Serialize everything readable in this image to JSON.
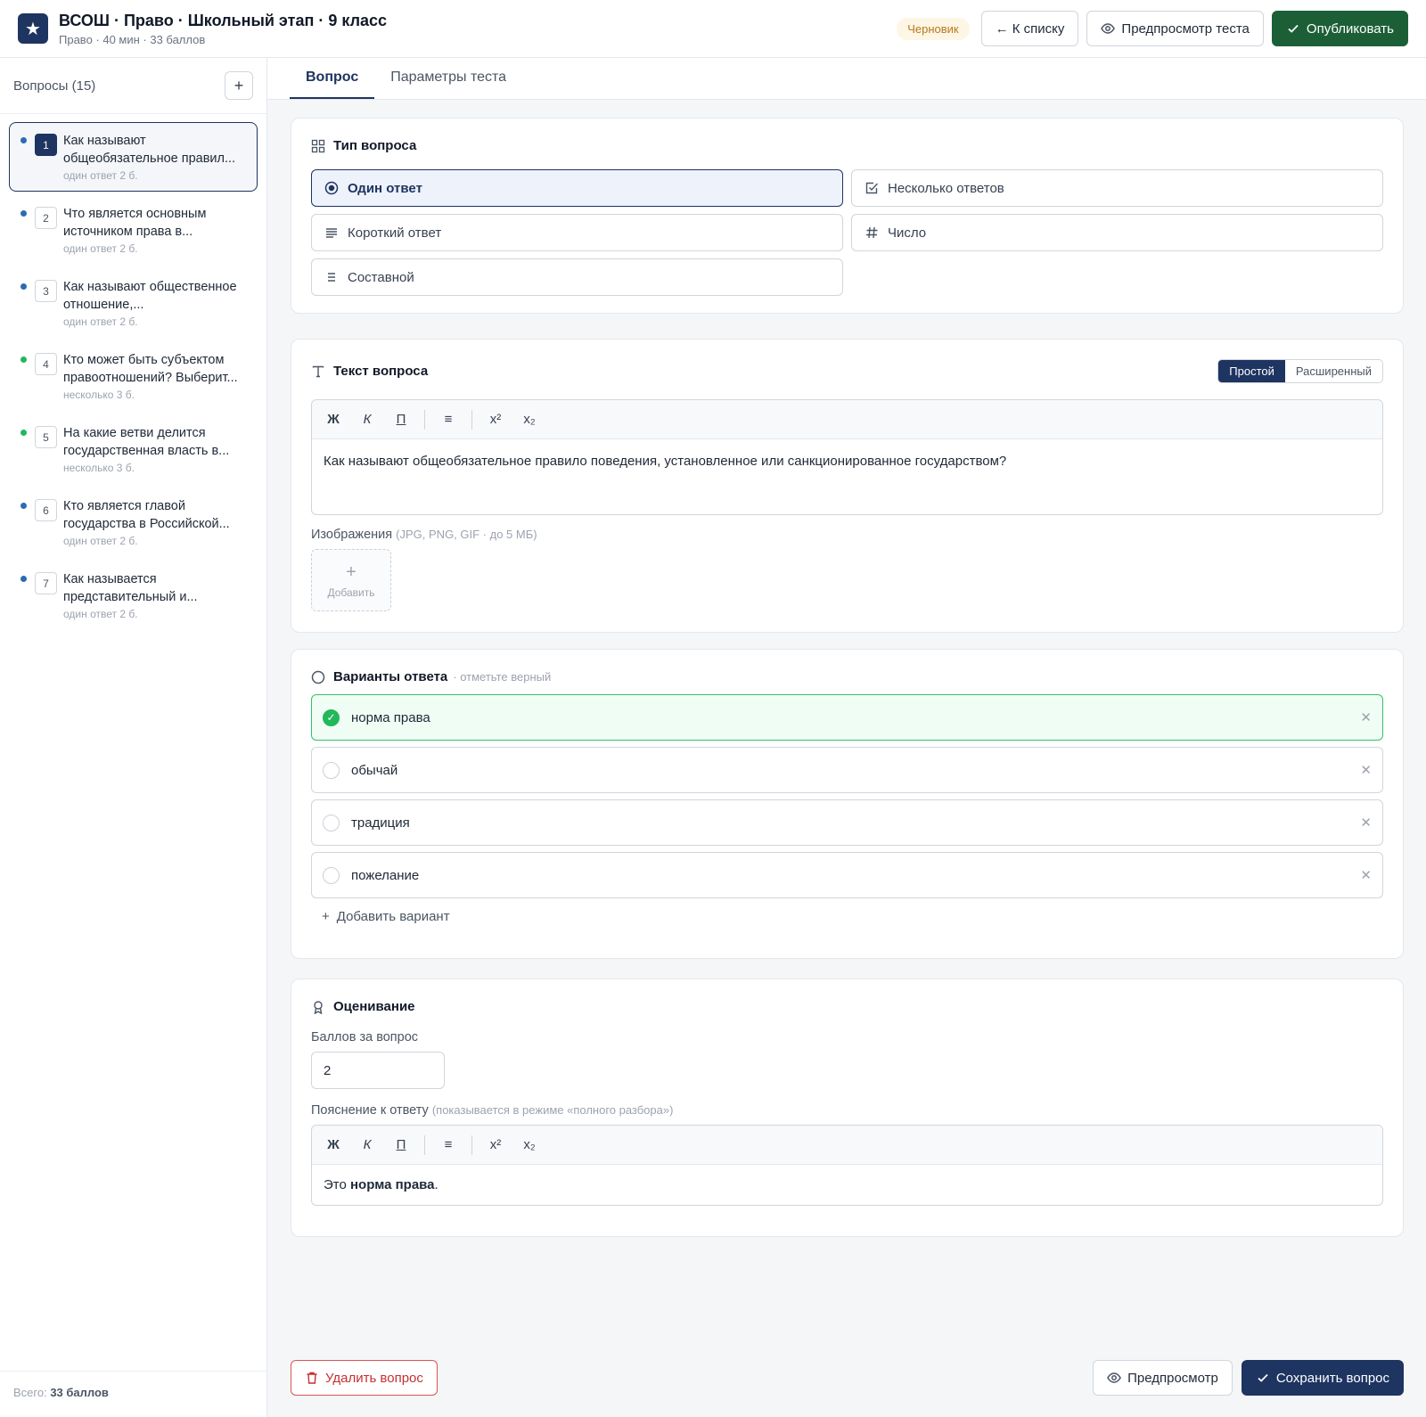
{
  "header": {
    "logo_glyph": "★",
    "title": "ВСОШ · Право · Школьный этап · 9 класс",
    "subtitle": "Право · 40 мин · 33 баллов",
    "status": "Черновик",
    "back_label": "← К списку",
    "preview_label": "Предпросмотр теста",
    "publish_label": "Опубликовать"
  },
  "sidebar": {
    "title": "Вопросы (15)",
    "add_label": "+",
    "items": [
      {
        "num": "1",
        "text": "Как называют общеобязательное правил...",
        "type": "один ответ",
        "points": "2 б.",
        "dot": "#2b6cb0",
        "active": true
      },
      {
        "num": "2",
        "text": "Что является основным источником права в...",
        "type": "один ответ",
        "points": "2 б.",
        "dot": "#2b6cb0"
      },
      {
        "num": "3",
        "text": "Как называют общественное отношение,...",
        "type": "один ответ",
        "points": "2 б.",
        "dot": "#2b6cb0"
      },
      {
        "num": "4",
        "text": "Кто может быть субъектом правоотношений? Выберит...",
        "type": "несколько",
        "points": "3 б.",
        "dot": "#22b85a"
      },
      {
        "num": "5",
        "text": "На какие ветви делится государственная власть в...",
        "type": "несколько",
        "points": "3 б.",
        "dot": "#22b85a"
      },
      {
        "num": "6",
        "text": "Кто является главой государства в Российской...",
        "type": "один ответ",
        "points": "2 б.",
        "dot": "#2b6cb0"
      },
      {
        "num": "7",
        "text": "Как называется представительный и...",
        "type": "один ответ",
        "points": "2 б.",
        "dot": "#2b6cb0"
      }
    ],
    "footer_prefix": "Всего: ",
    "footer_value": "33 баллов"
  },
  "tabs": {
    "question": "Вопрос",
    "params": "Параметры теста"
  },
  "type_card": {
    "title": "Тип вопроса",
    "single": "Один ответ",
    "multiple": "Несколько ответов",
    "short": "Короткий ответ",
    "number": "Число",
    "composite": "Составной"
  },
  "text_card": {
    "title": "Текст вопроса",
    "mode_simple": "Простой",
    "mode_advanced": "Расширенный",
    "tb_bold": "Ж",
    "tb_italic": "К",
    "tb_underline": "П",
    "tb_list": "≡",
    "tb_sup": "x²",
    "tb_sub": "x₂",
    "body": "Как называют общеобязательное правило поведения, установленное или санкционированное государством?",
    "images_label": "Изображения",
    "images_hint": "(JPG, PNG, GIF · до 5 МБ)",
    "add_plus": "+",
    "add_label": "Добавить"
  },
  "answers_card": {
    "title": "Варианты ответа",
    "hint": "· отметьте верный",
    "options": [
      {
        "text": "норма права",
        "correct": true
      },
      {
        "text": "обычай",
        "correct": false
      },
      {
        "text": "традиция",
        "correct": false
      },
      {
        "text": "пожелание",
        "correct": false
      }
    ],
    "remove_glyph": "✕",
    "check_glyph": "✓",
    "add_label": "Добавить вариант",
    "add_plus": "+"
  },
  "grading_card": {
    "title": "Оценивание",
    "points_label": "Баллов за вопрос",
    "points_value": "2",
    "expl_label": "Пояснение к ответу",
    "expl_hint": "(показывается в режиме «полного разбора»)",
    "expl_prefix": "Это ",
    "expl_bold": "норма права",
    "expl_suffix": "."
  },
  "footer": {
    "delete_label": "Удалить вопрос",
    "preview_label": "Предпросмотр",
    "save_label": "Сохранить вопрос"
  }
}
